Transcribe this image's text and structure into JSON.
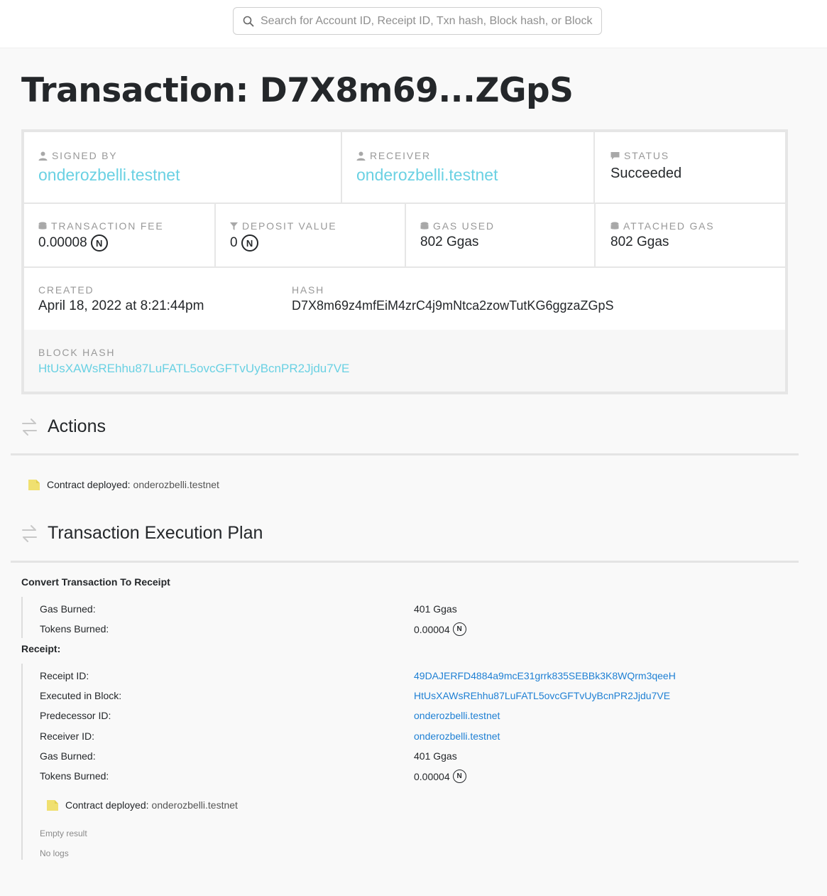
{
  "search": {
    "placeholder": "Search for Account ID, Receipt ID, Txn hash, Block hash, or Block height"
  },
  "title": "Transaction: D7X8m69...ZGpS",
  "summary": {
    "signed_by": {
      "label": "Signed by",
      "value": "onderozbelli.testnet"
    },
    "receiver": {
      "label": "Receiver",
      "value": "onderozbelli.testnet"
    },
    "status": {
      "label": "Status",
      "value": "Succeeded"
    },
    "transaction_fee": {
      "label": "Transaction Fee",
      "value": "0.00008"
    },
    "deposit_value": {
      "label": "Deposit Value",
      "value": "0"
    },
    "gas_used": {
      "label": "Gas Used",
      "value": "802 Ggas"
    },
    "attached_gas": {
      "label": "Attached Gas",
      "value": "802 Ggas"
    },
    "created": {
      "label": "Created",
      "value": "April 18, 2022 at 8:21:44pm"
    },
    "hash": {
      "label": "Hash",
      "value": "D7X8m69z4mfEiM4zrC4j9mNtca2zowTutKG6ggzaZGpS"
    },
    "block_hash": {
      "label": "Block Hash",
      "value": "HtUsXAWsREhhu87LuFATL5ovcGFTvUyBcnPR2Jjdu7VE"
    }
  },
  "near_symbol": "N",
  "actions": {
    "title": "Actions",
    "items": [
      {
        "label": "Contract deployed:",
        "account": "onderozbelli.testnet"
      }
    ]
  },
  "execution_plan": {
    "title": "Transaction Execution Plan",
    "convert": {
      "heading": "Convert Transaction To Receipt",
      "rows": [
        {
          "key": "Gas Burned:",
          "value": "401 Ggas"
        },
        {
          "key": "Tokens Burned:",
          "value": "0.00004"
        }
      ]
    },
    "receipt": {
      "heading": "Receipt:",
      "rows": [
        {
          "key": "Receipt ID:",
          "value": "49DAJERFD4884a9mcE31grrk835SEBBk3K8WQrm3qeeH"
        },
        {
          "key": "Executed in Block:",
          "value": "HtUsXAWsREhhu87LuFATL5ovcGFTvUyBcnPR2Jjdu7VE"
        },
        {
          "key": "Predecessor ID:",
          "value": "onderozbelli.testnet"
        },
        {
          "key": "Receiver ID:",
          "value": "onderozbelli.testnet"
        },
        {
          "key": "Gas Burned:",
          "value": "401 Ggas"
        },
        {
          "key": "Tokens Burned:",
          "value": "0.00004"
        }
      ],
      "action": {
        "label": "Contract deployed:",
        "account": "onderozbelli.testnet"
      },
      "result": "Empty result",
      "logs": "No logs"
    }
  },
  "colors": {
    "link": "#6ad1e3",
    "plan_link": "#1f80d4",
    "file_icon": "#f0e070"
  }
}
